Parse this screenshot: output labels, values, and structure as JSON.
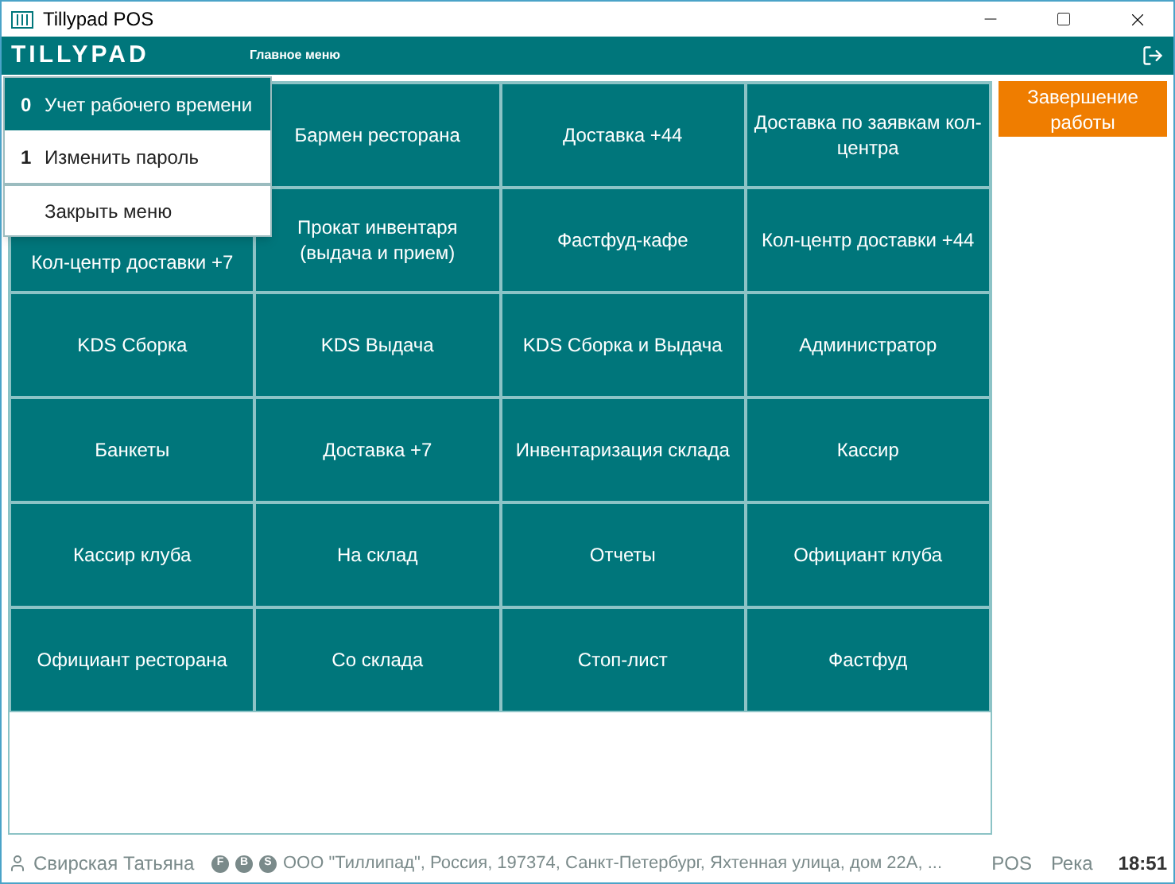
{
  "window": {
    "title": "Tillypad POS"
  },
  "header": {
    "logo": "TILLYPAD",
    "title": "Главное меню"
  },
  "menu": [
    {
      "key": "0",
      "label": "Учет рабочего времени",
      "selected": true
    },
    {
      "key": "1",
      "label": "Изменить пароль",
      "selected": false
    },
    {
      "label": "Закрыть меню",
      "selected": false
    }
  ],
  "tiles": [
    {
      "label": "Бармен ресторана"
    },
    {
      "label": "Доставка +44"
    },
    {
      "label": "Доставка по заявкам кол-центра"
    },
    {
      "label": "Кол-центр доставки +7"
    },
    {
      "label": "Прокат инвентаря (выдача и прием)"
    },
    {
      "label": "Фастфуд-кафе"
    },
    {
      "label": "Кол-центр доставки +44"
    },
    {
      "label": "KDS Сборка"
    },
    {
      "label": "KDS Выдача"
    },
    {
      "label": "KDS Сборка и Выдача"
    },
    {
      "label": "Администратор"
    },
    {
      "label": "Банкеты"
    },
    {
      "label": "Доставка +7"
    },
    {
      "label": "Инвентаризация склада"
    },
    {
      "label": "Кассир"
    },
    {
      "label": "Кассир клуба"
    },
    {
      "label": "На склад"
    },
    {
      "label": "Отчеты"
    },
    {
      "label": "Официант клуба"
    },
    {
      "label": "Официант ресторана"
    },
    {
      "label": "Со склада"
    },
    {
      "label": "Стоп-лист"
    },
    {
      "label": "Фастфуд"
    }
  ],
  "side_button": "Завершение работы",
  "status_bar": {
    "user": "Свирская Татьяна",
    "badges": [
      "F",
      "B",
      "S"
    ],
    "company": "ООО \"Тиллипад\", Россия, 197374, Санкт-Петербург, Яхтенная улица, дом 22А, ...",
    "mode": "POS",
    "location": "Река",
    "time": "18:51"
  }
}
